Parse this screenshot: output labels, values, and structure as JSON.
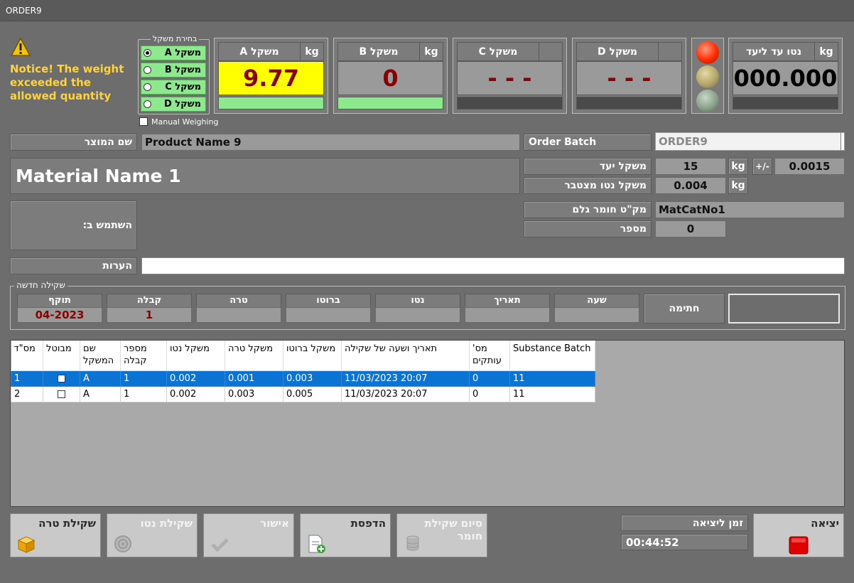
{
  "window": {
    "title": "ORDER9"
  },
  "notice": {
    "text": "Notice! The weight exceeded the allowed quantity"
  },
  "scale_select": {
    "legend": "בחירת משקל",
    "options": [
      "משקל A",
      "משקל B",
      "משקל C",
      "משקל D"
    ],
    "selected_index": 0,
    "manual_weighing_label": "Manual Weighing"
  },
  "scales": [
    {
      "name": "משקל A",
      "unit": "kg",
      "value": "9.77"
    },
    {
      "name": "משקל B",
      "unit": "kg",
      "value": "0"
    },
    {
      "name": "משקל C",
      "unit": "",
      "value": "- - -"
    },
    {
      "name": "משקל D",
      "unit": "",
      "value": "- - -"
    }
  ],
  "net_to_target": {
    "label": "נטו עד ליעד",
    "unit": "kg",
    "value": "000.000"
  },
  "traffic_light": {
    "active": "red",
    "colors": {
      "red": "#ff2a00",
      "yellow": "#b5a76a",
      "green": "#8aa08a"
    }
  },
  "product": {
    "label": "שם המוצר",
    "value": "Product Name 9"
  },
  "material": {
    "value": "Material Name 1"
  },
  "used_in": {
    "label": "השתמש ב:"
  },
  "notes": {
    "label": "הערות",
    "value": ""
  },
  "order_batch": {
    "label": "Order Batch",
    "value": "ORDER9"
  },
  "target_weight": {
    "label": "משקל יעד",
    "value": "15",
    "unit": "kg",
    "tolerance_label": "+/-",
    "tolerance": "0.0015"
  },
  "accum_net": {
    "label": "משקל נטו מצטבר",
    "value": "0.004",
    "unit": "kg"
  },
  "raw_material_code": {
    "label": "מק\"ט חומר גלם",
    "value": "MatCatNo1"
  },
  "number": {
    "label": "מספר",
    "value": "0"
  },
  "new_weighing": {
    "legend": "שקילה חדשה",
    "headers": [
      "תוקף",
      "קבלה",
      "טרה",
      "ברוטו",
      "נטו",
      "תאריך",
      "שעה"
    ],
    "values": [
      "04-2023",
      "1",
      "",
      "",
      "",
      "",
      ""
    ],
    "signature_label": "חתימה"
  },
  "table": {
    "columns": [
      "מס\"ד",
      "מבוטל",
      "שם המשקל",
      "מספר קבלה",
      "משקל נטו",
      "משקל טרה",
      "משקל ברוטו",
      "תאריך ושעה של שקילה",
      "מס' עותקים",
      "Substance Batch"
    ],
    "rows": [
      {
        "seq": "1",
        "scale": "A",
        "receipt": "1",
        "net": "0.002",
        "tare": "0.001",
        "gross": "0.003",
        "datetime": "11/03/2023 20:07",
        "copies": "0",
        "batch": "11",
        "selected": true
      },
      {
        "seq": "2",
        "scale": "A",
        "receipt": "1",
        "net": "0.002",
        "tare": "0.003",
        "gross": "0.005",
        "datetime": "11/03/2023 20:07",
        "copies": "0",
        "batch": "11",
        "selected": false
      }
    ]
  },
  "buttons": {
    "tare": "שקילת טרה",
    "net": "שקילת נטו",
    "approve": "אישור",
    "print": "הדפסת",
    "finish": "סיום שקילת חומר"
  },
  "exit_time": {
    "label": "זמן ליציאה",
    "value": "00:44:52"
  },
  "exit": {
    "label": "יציאה"
  }
}
